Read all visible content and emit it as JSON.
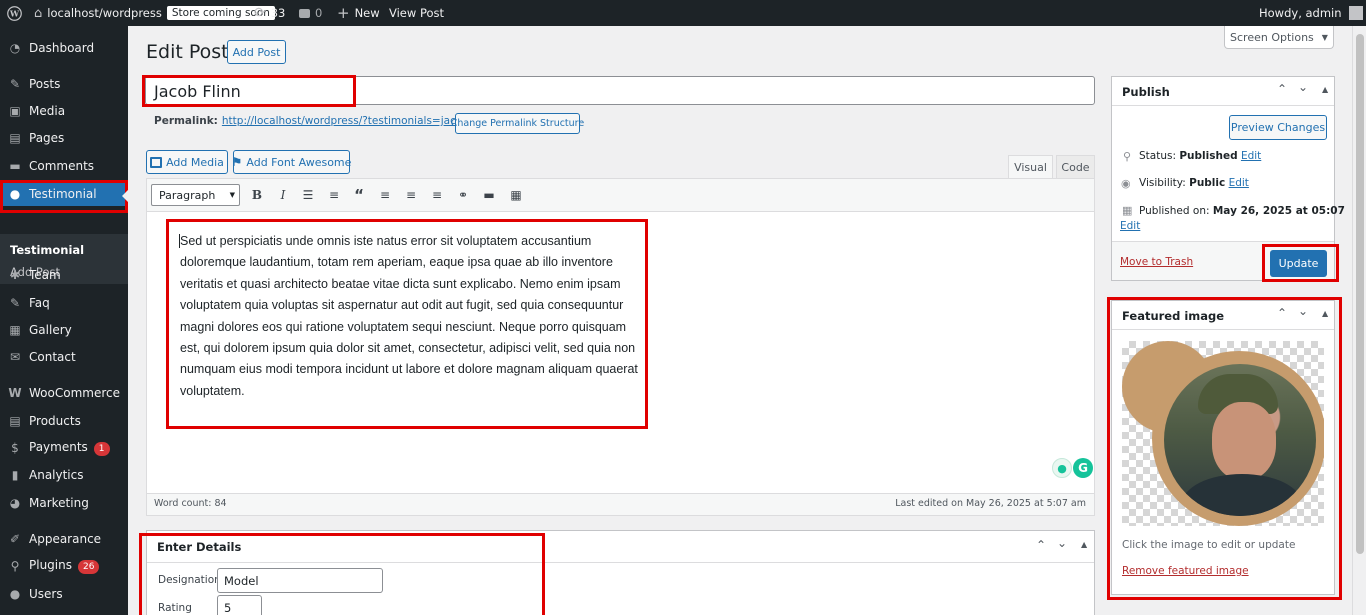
{
  "adminbar": {
    "site": "localhost/wordpress",
    "store_badge": "Store coming soon",
    "updates": "33",
    "comments": "0",
    "new": "New",
    "view_post": "View Post",
    "howdy": "Howdy, admin"
  },
  "sidebar": {
    "dashboard": "Dashboard",
    "posts": "Posts",
    "media": "Media",
    "pages": "Pages",
    "comments": "Comments",
    "testimonial": "Testimonial",
    "sub_testimonial": "Testimonial",
    "sub_add_post": "Add Post",
    "team": "Team",
    "faq": "Faq",
    "gallery": "Gallery",
    "contact": "Contact",
    "woocommerce": "WooCommerce",
    "products": "Products",
    "payments": "Payments",
    "payments_count": "1",
    "analytics": "Analytics",
    "marketing": "Marketing",
    "appearance": "Appearance",
    "plugins": "Plugins",
    "plugins_count": "26",
    "users": "Users"
  },
  "page": {
    "title": "Edit Post",
    "add_post": "Add Post",
    "screen_options": "Screen Options",
    "post_title": "Jacob Flinn",
    "permalink_label": "Permalink:",
    "permalink_url": "http://localhost/wordpress/?testimonials=jacob-flinn",
    "change_permalink": "Change Permalink Structure"
  },
  "editor": {
    "add_media": "Add Media",
    "add_font_awesome": "Add Font Awesome",
    "tab_visual": "Visual",
    "tab_code": "Code",
    "format": "Paragraph",
    "content": "Sed ut perspiciatis unde omnis iste natus error sit voluptatem accusantium doloremque laudantium, totam rem aperiam, eaque ipsa quae ab illo inventore veritatis et quasi architecto beatae vitae dicta sunt explicabo. Nemo enim ipsam voluptatem quia voluptas sit aspernatur aut odit aut fugit, sed quia consequuntur magni dolores eos qui ratione voluptatem sequi nesciunt. Neque porro quisquam est, qui dolorem ipsum quia dolor sit amet, consectetur, adipisci velit, sed quia non numquam eius modi tempora incidunt ut labore et dolore magnam aliquam quaerat voluptatem.",
    "word_count": "Word count: 84",
    "last_edited": "Last edited on May 26, 2025 at 5:07 am"
  },
  "details": {
    "title": "Enter Details",
    "designation_label": "Designation",
    "designation_value": "Model",
    "rating_label": "Rating",
    "rating_value": "5"
  },
  "publish": {
    "title": "Publish",
    "preview": "Preview Changes",
    "status_label": "Status:",
    "status_value": "Published",
    "visibility_label": "Visibility:",
    "visibility_value": "Public",
    "published_label": "Published on:",
    "published_value": "May 26, 2025 at 05:07",
    "edit": "Edit",
    "trash": "Move to Trash",
    "update": "Update"
  },
  "featured": {
    "title": "Featured image",
    "hint": "Click the image to edit or update",
    "remove": "Remove featured image"
  },
  "colors": {
    "accent": "#2271b1",
    "highlight": "#e00000",
    "sidebar": "#1d2327"
  }
}
